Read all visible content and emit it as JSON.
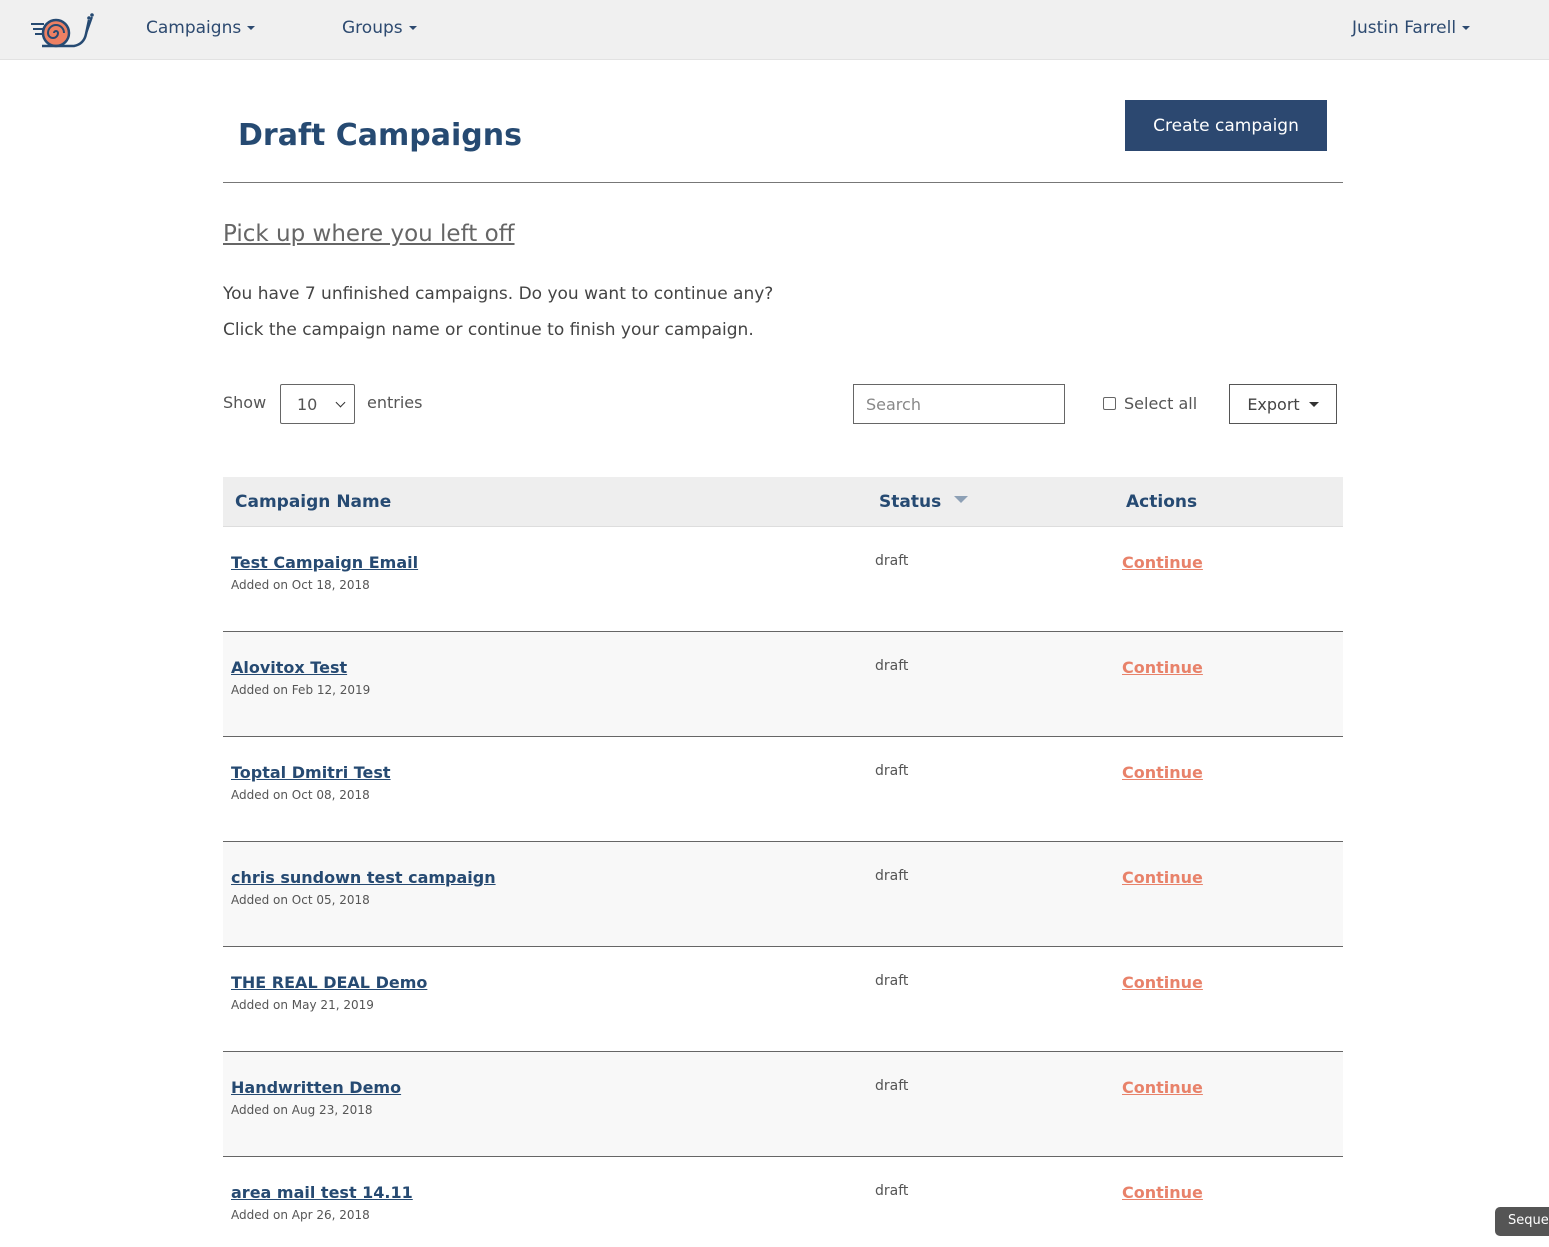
{
  "navbar": {
    "campaigns_label": "Campaigns",
    "groups_label": "Groups",
    "user_label": "Justin Farrell"
  },
  "header": {
    "title": "Draft Campaigns",
    "create_button": "Create campaign"
  },
  "intro": {
    "subtitle": "Pick up where you left off",
    "line1": "You have 7 unfinished campaigns. Do you want to continue any?",
    "line2": "Click the campaign name or continue to finish your campaign."
  },
  "controls": {
    "show_label": "Show",
    "entries_value": "10",
    "entries_label": "entries",
    "search_placeholder": "Search",
    "select_all_label": "Select all",
    "export_label": "Export"
  },
  "table": {
    "headers": {
      "name": "Campaign Name",
      "status": "Status",
      "actions": "Actions"
    },
    "rows": [
      {
        "name": "Test Campaign Email",
        "date": "Added on Oct 18, 2018",
        "status": "draft",
        "action": "Continue"
      },
      {
        "name": "Alovitox Test",
        "date": "Added on Feb 12, 2019",
        "status": "draft",
        "action": "Continue"
      },
      {
        "name": "Toptal Dmitri Test",
        "date": "Added on Oct 08, 2018",
        "status": "draft",
        "action": "Continue"
      },
      {
        "name": "chris sundown test campaign",
        "date": "Added on Oct 05, 2018",
        "status": "draft",
        "action": "Continue"
      },
      {
        "name": "THE REAL DEAL Demo",
        "date": "Added on May 21, 2019",
        "status": "draft",
        "action": "Continue"
      },
      {
        "name": "Handwritten Demo",
        "date": "Added on Aug 23, 2018",
        "status": "draft",
        "action": "Continue"
      },
      {
        "name": "area mail test 14.11",
        "date": "Added on Apr 26, 2018",
        "status": "draft",
        "action": "Continue"
      }
    ]
  },
  "tooltip": {
    "label": "Seque"
  },
  "colors": {
    "primary": "#2c4870",
    "heading": "#264a72",
    "accent": "#e8826a",
    "navbar_bg": "#f0f0f0"
  },
  "icons": {
    "logo": "snail-logo-icon",
    "sort": "sort-desc-icon",
    "dropdown": "caret-down-icon"
  }
}
